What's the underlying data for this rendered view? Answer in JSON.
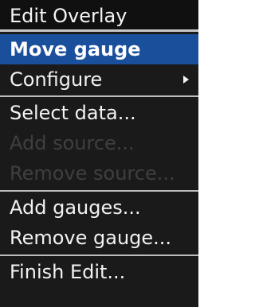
{
  "menu": {
    "title": "Edit Overlay",
    "items": [
      {
        "label": "Move gauge"
      },
      {
        "label": "Configure"
      },
      {
        "label": "Select data..."
      },
      {
        "label": "Add source..."
      },
      {
        "label": "Remove source..."
      },
      {
        "label": "Add gauges..."
      },
      {
        "label": "Remove gauge..."
      },
      {
        "label": "Finish Edit..."
      }
    ]
  },
  "colors": {
    "menu_background": "#1a1a1a",
    "selected_background": "#1a4f9b",
    "divider": "#bdbdbd",
    "disabled_text": "#3f3f3f",
    "text": "#f2f2f2"
  },
  "icons": {
    "submenu_arrow": "chevron-right-icon"
  }
}
